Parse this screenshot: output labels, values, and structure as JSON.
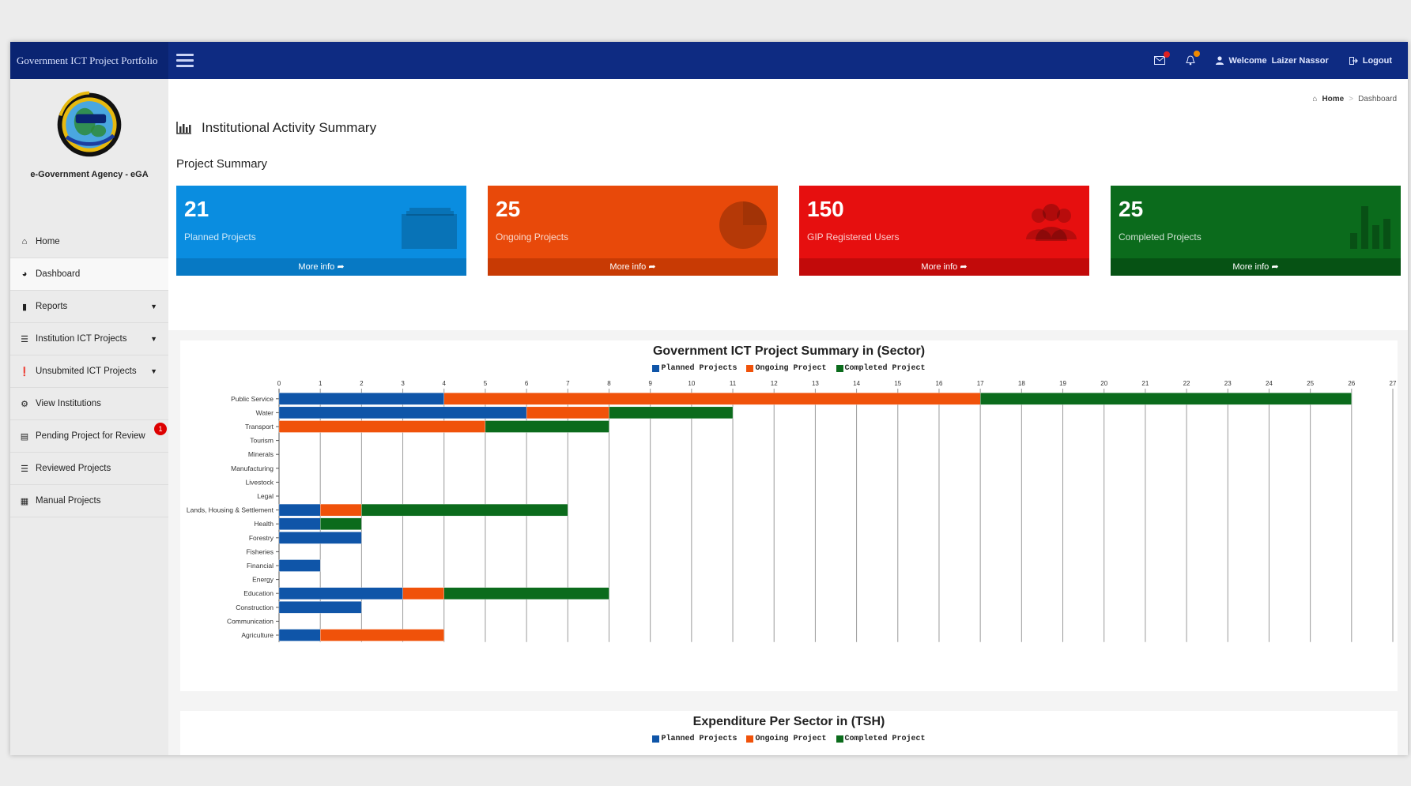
{
  "app": {
    "title": "Government ICT Project Portfolio"
  },
  "topbar": {
    "welcome_label": "Welcome",
    "user_name": "Laizer Nassor",
    "logout_label": "Logout",
    "mail_dot_color": "#e02020",
    "bell_dot_color": "#f08a00"
  },
  "sidebar": {
    "agency_name": "e-Government Agency - eGA",
    "items": [
      {
        "label": "Home",
        "icon": "home-icon"
      },
      {
        "label": "Dashboard",
        "icon": "dashboard-icon"
      },
      {
        "label": "Reports",
        "icon": "book-icon"
      },
      {
        "label": "Institution ICT Projects",
        "icon": "list-icon"
      },
      {
        "label": "Unsubmited ICT Projects",
        "icon": "info-icon"
      },
      {
        "label": "View Institutions",
        "icon": "gear-icon"
      },
      {
        "label": "Pending Project for Review",
        "icon": "table-icon",
        "badge": "1"
      },
      {
        "label": "Reviewed Projects",
        "icon": "list-icon"
      },
      {
        "label": "Manual Projects",
        "icon": "grid-icon"
      }
    ]
  },
  "breadcrumb": {
    "home": "Home",
    "current": "Dashboard"
  },
  "page": {
    "title": "Institutional Activity Summary",
    "section": "Project Summary"
  },
  "boxes": [
    {
      "value": "21",
      "label": "Planned Projects",
      "more": "More info",
      "color": "#0a8de0",
      "footer_color": "#0779c4",
      "icon": "folder-icon"
    },
    {
      "value": "25",
      "label": "Ongoing Projects",
      "more": "More info",
      "color": "#e8490a",
      "footer_color": "#c83a04",
      "icon": "pie-chart-icon"
    },
    {
      "value": "150",
      "label": "GIP Registered Users",
      "more": "More info",
      "color": "#e60f0f",
      "footer_color": "#c20a0a",
      "icon": "users-icon"
    },
    {
      "value": "25",
      "label": "Completed Projects",
      "more": "More info",
      "color": "#0b6b1c",
      "footer_color": "#065214",
      "icon": "bar-chart-icon"
    }
  ],
  "chart_data": [
    {
      "type": "bar",
      "orientation": "horizontal",
      "stacked": true,
      "title": "Government ICT Project Summary in (Sector)",
      "categories": [
        "Public Service",
        "Water",
        "Transport",
        "Tourism",
        "Minerals",
        "Manufacturing",
        "Livestock",
        "Legal",
        "Lands, Housing & Settlement",
        "Health",
        "Forestry",
        "Fisheries",
        "Financial",
        "Energy",
        "Education",
        "Construction",
        "Communication",
        "Agriculture"
      ],
      "series": [
        {
          "name": "Planned Projects",
          "color": "#0f55a8",
          "values": [
            4,
            6,
            0,
            0,
            0,
            0,
            0,
            0,
            1,
            1,
            2,
            0,
            1,
            0,
            3,
            2,
            0,
            1
          ]
        },
        {
          "name": "Ongoing Project",
          "color": "#f0520a",
          "values": [
            13,
            2,
            5,
            0,
            0,
            0,
            0,
            0,
            1,
            0,
            0,
            0,
            0,
            0,
            1,
            0,
            0,
            3
          ]
        },
        {
          "name": "Completed Project",
          "color": "#0b6b1c",
          "values": [
            9,
            3,
            3,
            0,
            0,
            0,
            0,
            0,
            5,
            1,
            0,
            0,
            0,
            0,
            4,
            0,
            0,
            0
          ]
        }
      ],
      "xlim": [
        0,
        27
      ],
      "xticks": [
        0,
        1,
        2,
        3,
        4,
        5,
        6,
        7,
        8,
        9,
        10,
        11,
        12,
        13,
        14,
        15,
        16,
        17,
        18,
        19,
        20,
        21,
        22,
        23,
        24,
        25,
        26,
        27
      ],
      "grid": true,
      "legend": "top"
    },
    {
      "type": "bar",
      "title": "Expenditure Per Sector in (TSH)",
      "series": [
        {
          "name": "Planned Projects",
          "color": "#0f55a8"
        },
        {
          "name": "Ongoing Project",
          "color": "#f0520a"
        },
        {
          "name": "Completed Project",
          "color": "#0b6b1c"
        }
      ],
      "legend": "top"
    }
  ]
}
